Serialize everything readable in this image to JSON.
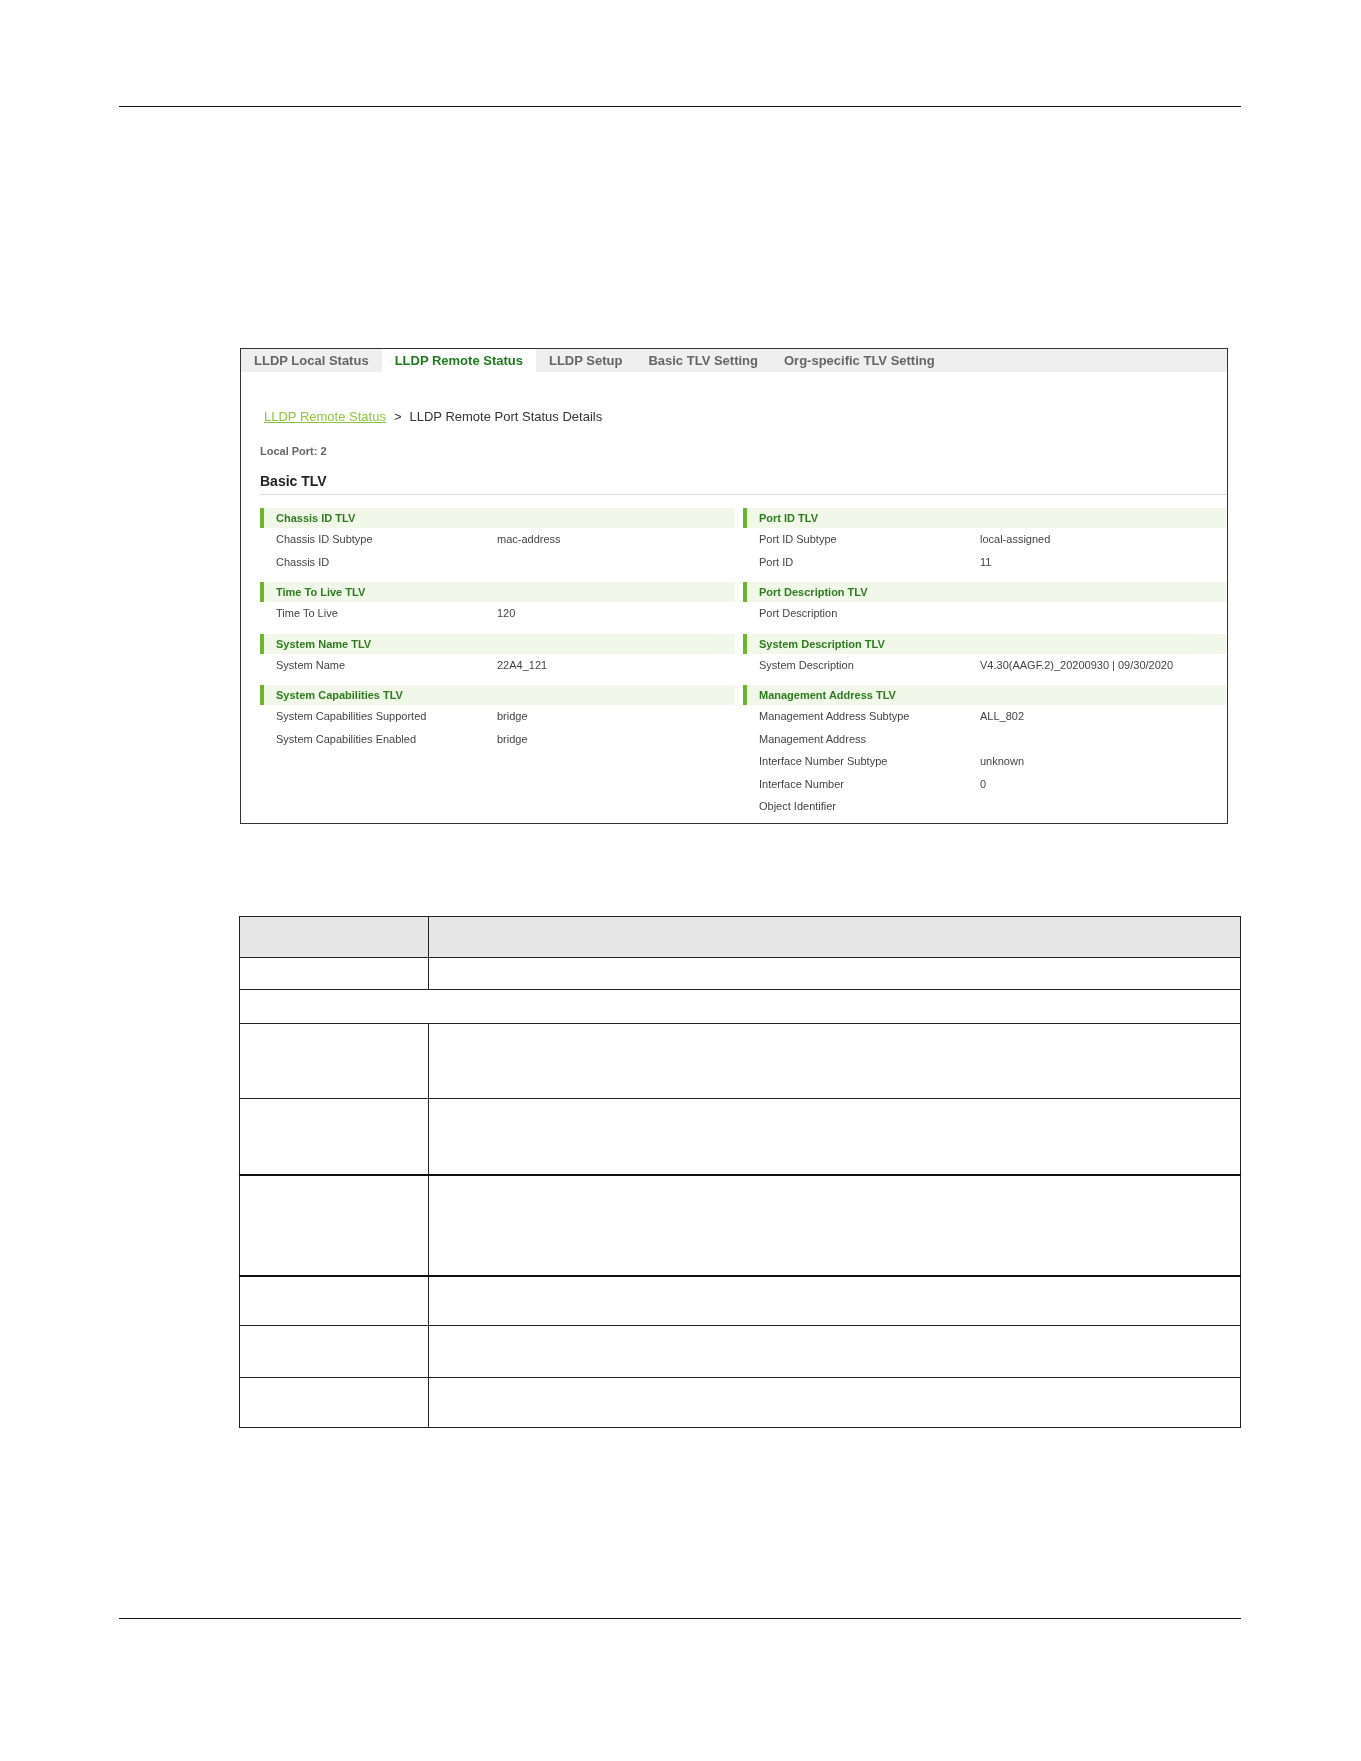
{
  "tabs": [
    {
      "label": "LLDP Local Status",
      "selected": false
    },
    {
      "label": "LLDP Remote Status",
      "selected": true
    },
    {
      "label": "LLDP Setup",
      "selected": false
    },
    {
      "label": "Basic TLV Setting",
      "selected": false
    },
    {
      "label": "Org-specific TLV Setting",
      "selected": false
    }
  ],
  "breadcrumb": {
    "link": "LLDP Remote Status",
    "separator": ">",
    "current": "LLDP Remote Port Status Details"
  },
  "local_port": "Local Port: 2",
  "section_title": "Basic TLV",
  "columns": [
    {
      "sections": [
        {
          "title": "Chassis ID TLV",
          "rows": [
            {
              "label": "Chassis ID Subtype",
              "value": "mac-address"
            },
            {
              "label": "Chassis ID"
            }
          ]
        },
        {
          "title": "Time To Live TLV",
          "rows": [
            {
              "label": "Time To Live",
              "value": "120"
            }
          ]
        },
        {
          "title": "System Name TLV",
          "rows": [
            {
              "label": "System Name",
              "value": "22A4_121"
            }
          ]
        },
        {
          "title": "System Capabilities TLV",
          "rows": [
            {
              "label": "System Capabilities Supported",
              "value": "bridge"
            },
            {
              "label": "System Capabilities Enabled",
              "value": "bridge"
            }
          ]
        }
      ]
    },
    {
      "sections": [
        {
          "title": "Port ID TLV",
          "rows": [
            {
              "label": "Port ID Subtype",
              "value": "local-assigned"
            },
            {
              "label": "Port ID",
              "value": "11"
            }
          ]
        },
        {
          "title": "Port Description TLV",
          "rows": [
            {
              "label": "Port Description"
            }
          ]
        },
        {
          "title": "System Description TLV",
          "rows": [
            {
              "label": "System Description",
              "value": "V4.30(AAGF.2)_20200930 | 09/30/2020"
            }
          ]
        },
        {
          "title": "Management Address TLV",
          "rows": [
            {
              "label": "Management Address Subtype",
              "value": "ALL_802"
            },
            {
              "label": "Management Address"
            },
            {
              "label": "Interface Number Subtype",
              "value": "unknown"
            },
            {
              "label": "Interface Number",
              "value": "0"
            },
            {
              "label": "Object Identifier"
            }
          ]
        }
      ]
    }
  ],
  "table": {
    "rows": [
      {
        "kind": "header"
      },
      {
        "kind": "pair"
      },
      {
        "kind": "span"
      },
      {
        "kind": "pair"
      },
      {
        "kind": "pair"
      },
      {
        "kind": "pair"
      },
      {
        "kind": "pair"
      },
      {
        "kind": "pair"
      },
      {
        "kind": "pair"
      }
    ]
  }
}
